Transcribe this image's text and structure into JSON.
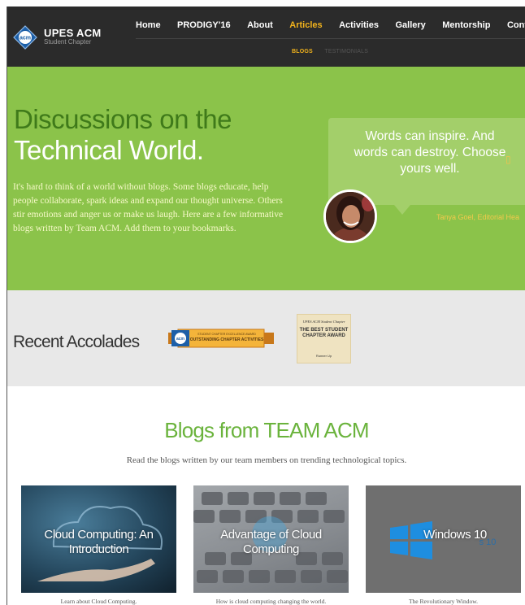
{
  "nav": {
    "logo_name": "UPES ACM",
    "logo_sub": "Student Chapter",
    "logo_badge": "acm",
    "items": [
      {
        "label": "Home"
      },
      {
        "label": "PRODIGY'16"
      },
      {
        "label": "About"
      },
      {
        "label": "Articles",
        "active": true
      },
      {
        "label": "Activities"
      },
      {
        "label": "Gallery"
      },
      {
        "label": "Mentorship"
      },
      {
        "label": "Contac"
      }
    ],
    "subitems": [
      {
        "label": "BLOGS",
        "active": true
      },
      {
        "label": "TESTIMONIALS"
      }
    ]
  },
  "hero": {
    "title_line1": "Discussions on the",
    "title_line2": "Technical World.",
    "paragraph": "It's hard to think of a world without blogs. Some blogs educate, help people collaborate, spark ideas and expand our thought universe. Others stir emotions and anger us or make us laugh. Here are a few informative blogs written by Team ACM. Add them to your bookmarks.",
    "quote": "Words can inspire. And words can destroy. Choose yours well.",
    "quote_icon": "quote-icon",
    "quote_author": "Tanya Goel, Editorial Hea"
  },
  "accolades": {
    "title": "Recent Accolades",
    "ribbon_text": "OUTSTANDING CHAPTER ACTIVITIES",
    "ribbon_top": "STUDENT CHAPTER EXCELLENCE AWARD",
    "award_line1": "UPES ACM Student Chapter",
    "award_line2": "THE BEST STUDENT CHAPTER AWARD",
    "award_line3": "Runner Up"
  },
  "blogs": {
    "title": "Blogs from TEAM ACM",
    "subtitle": "Read the blogs written by our team members on trending technological topics.",
    "cards": [
      {
        "title": "Cloud Computing: An Introduction",
        "desc": "Learn about Cloud Computing."
      },
      {
        "title": "Advantage of Cloud Computing",
        "desc": "How is cloud computing changing the world."
      },
      {
        "title": "Windows 10",
        "desc": "The Revolutionary Window.",
        "ghost": "s 10"
      }
    ]
  },
  "colors": {
    "nav_bg": "#2b2b2b",
    "accent": "#f2b31c",
    "hero_bg": "#8bc34a",
    "blogs_title": "#6ab33c"
  }
}
